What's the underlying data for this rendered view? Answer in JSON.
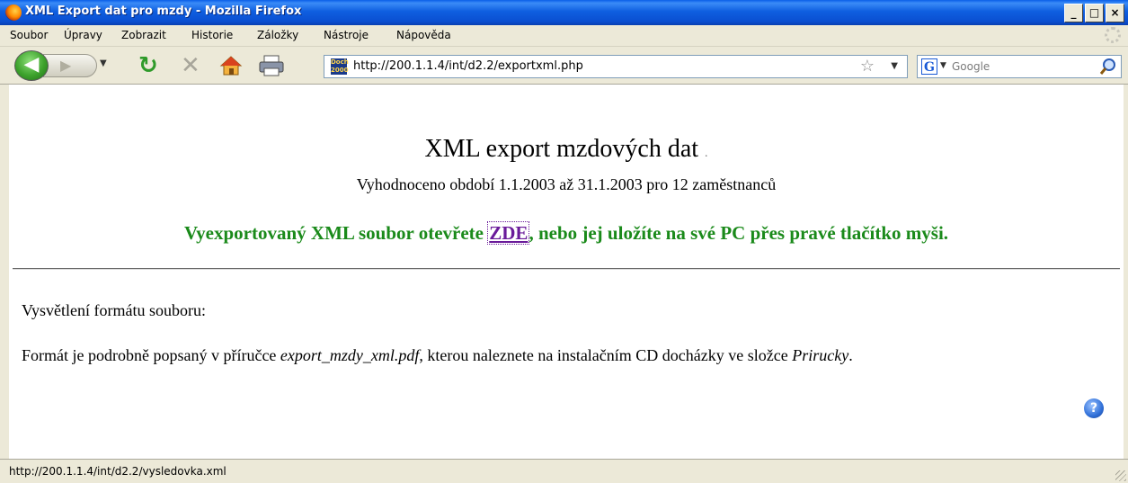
{
  "window": {
    "title": "XML Export dat pro mzdy - Mozilla Firefox",
    "minimize": "_",
    "maximize": "□",
    "close": "×"
  },
  "menu": {
    "items": [
      {
        "label": "Soubor"
      },
      {
        "label": "Úpravy"
      },
      {
        "label": "Zobrazit"
      },
      {
        "label": "Historie"
      },
      {
        "label": "Záložky"
      },
      {
        "label": "Nástroje"
      },
      {
        "label": "Nápověda"
      }
    ]
  },
  "toolbar": {
    "url": "http://200.1.1.4/int/d2.2/exportxml.php",
    "site_icon_text": "Doch 2000",
    "search_engine": "G",
    "search_placeholder": "Google"
  },
  "page": {
    "title": "XML export mzdových dat",
    "title_dot": ".",
    "subtitle": "Vyhodnoceno období 1.1.2003 až 31.1.2003 pro 12 zaměstnanců",
    "export_before": "Vyexportovaný XML soubor otevřete ",
    "export_link": "ZDE",
    "export_after": ", nebo jej uložíte na své PC přes pravé tlačítko myši.",
    "explain_label": "Vysvětlení formátu souboru:",
    "explain_pre": "Formát je podrobně popsaný v příručce ",
    "explain_file": "export_mzdy_xml.pdf",
    "explain_mid": ", kterou naleznete na instalačním CD docházky ve složce ",
    "explain_folder": "Prirucky",
    "explain_end": ".",
    "help": "?"
  },
  "status": {
    "text": "http://200.1.1.4/int/d2.2/vysledovka.xml"
  },
  "colors": {
    "export_text": "#1a8a1a",
    "link": "#6a1b9a",
    "titlebar": "#0a4fd1"
  }
}
